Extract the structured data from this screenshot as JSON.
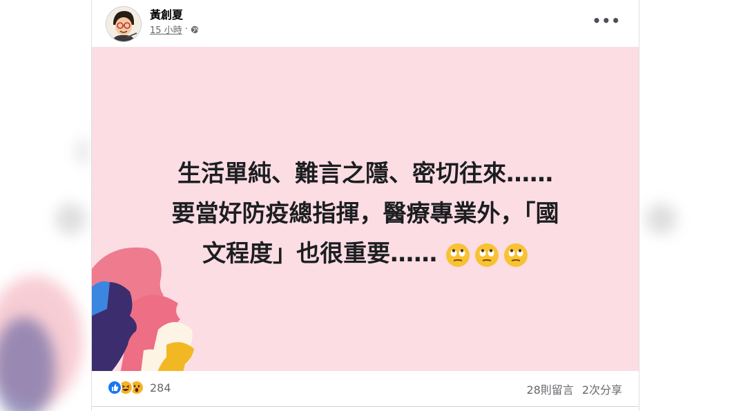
{
  "post": {
    "author": "黃創夏",
    "time": "15 小時",
    "separator": "·",
    "privacy_icon": "globe-icon",
    "more_label": "•••"
  },
  "card": {
    "background": "#fbdde3",
    "line1": "生活單純、難言之隱、密切往來……",
    "line2": "要當好防疫總指揮，醫療專業外，「國",
    "line3": "文程度」也很重要……",
    "emoji": [
      "eye-roll-emoji",
      "eye-roll-emoji",
      "eye-roll-emoji"
    ]
  },
  "footer": {
    "reaction_icons": [
      "like-icon",
      "haha-icon",
      "wow-icon"
    ],
    "reaction_count": "284",
    "comments": "28則留言",
    "shares": "2次分享"
  },
  "colors": {
    "like": "#1877f2",
    "haha": "#f7b125",
    "wow": "#f7b125"
  }
}
